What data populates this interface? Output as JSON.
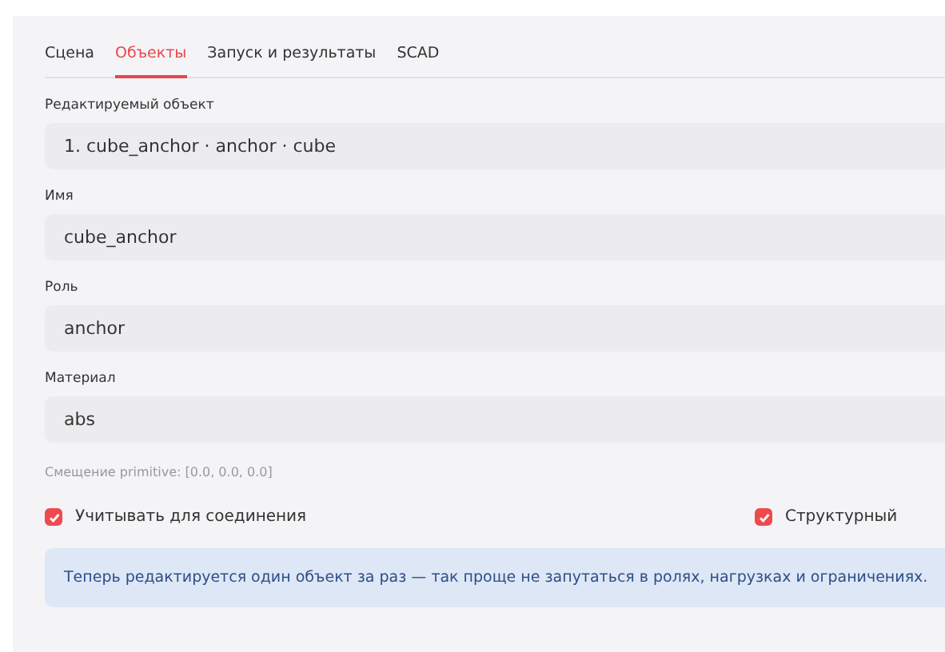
{
  "tabs": [
    {
      "label": "Сцена",
      "selected": false
    },
    {
      "label": "Объекты",
      "selected": true
    },
    {
      "label": "Запуск и результаты",
      "selected": false
    },
    {
      "label": "SCAD",
      "selected": false
    }
  ],
  "fields": [
    {
      "label": "Редактируемый объект",
      "value": "1. cube_anchor · anchor · cube"
    },
    {
      "label": "Имя",
      "value": "cube_anchor"
    },
    {
      "label": "Роль",
      "value": "anchor"
    },
    {
      "label": "Материал",
      "value": "abs"
    }
  ],
  "caption": "Смещение primitive: [0.0, 0.0, 0.0]",
  "checkboxes": [
    {
      "label": "Учитывать для соединения",
      "checked": true
    },
    {
      "label": "Структурный",
      "checked": true
    }
  ],
  "info": "Теперь редактируется один объект за раз — так проще не запутаться в ролях, нагрузках и ограничениях."
}
